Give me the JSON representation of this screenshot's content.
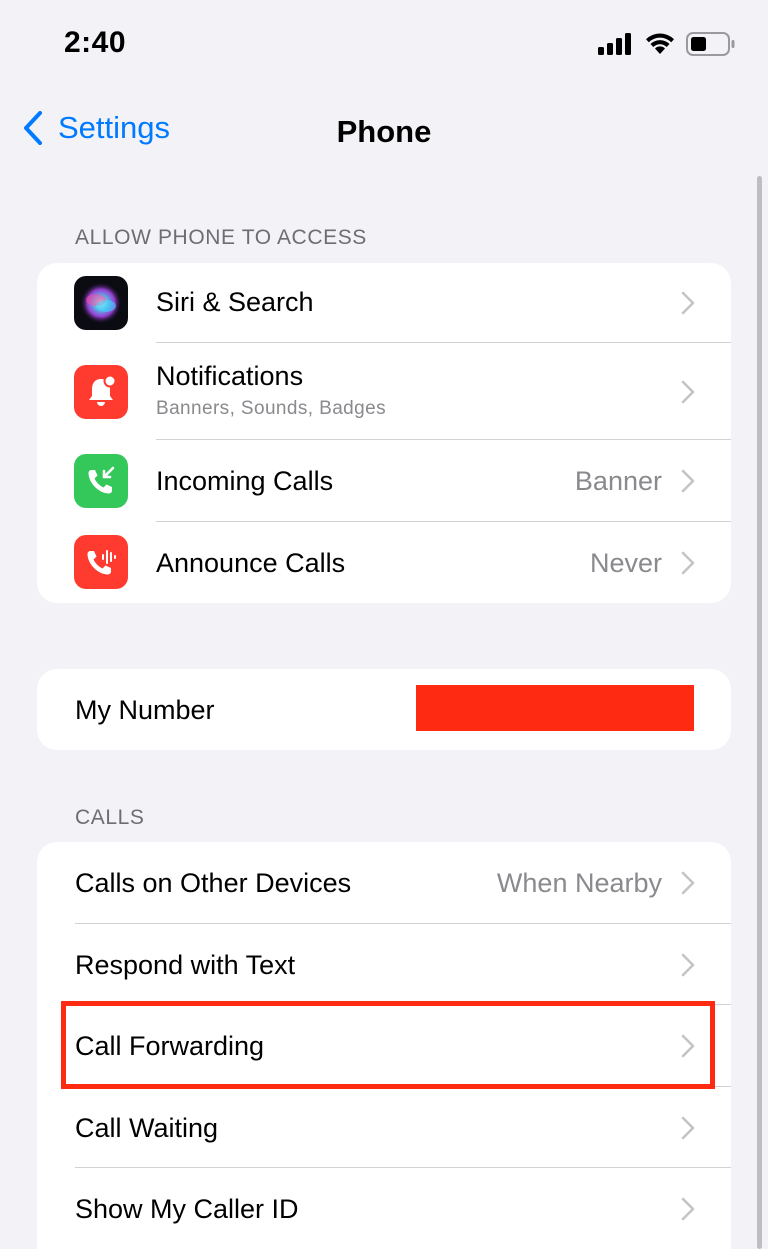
{
  "status_bar": {
    "time": "2:40",
    "icons": [
      "cellular-signal-icon",
      "wifi-icon",
      "battery-icon"
    ]
  },
  "nav": {
    "back_label": "Settings",
    "title": "Phone"
  },
  "sections": {
    "access_header": "ALLOW PHONE TO ACCESS",
    "calls_header": "CALLS"
  },
  "access_items": [
    {
      "label": "Siri & Search",
      "sublabel": "",
      "value": "",
      "icon": "siri-icon"
    },
    {
      "label": "Notifications",
      "sublabel": "Banners, Sounds, Badges",
      "value": "",
      "icon": "notifications-icon"
    },
    {
      "label": "Incoming Calls",
      "sublabel": "",
      "value": "Banner",
      "icon": "incoming-calls-icon"
    },
    {
      "label": "Announce Calls",
      "sublabel": "",
      "value": "Never",
      "icon": "announce-calls-icon"
    }
  ],
  "my_number": {
    "label": "My Number"
  },
  "calls_items": [
    {
      "label": "Calls on Other Devices",
      "value": "When Nearby"
    },
    {
      "label": "Respond with Text",
      "value": ""
    },
    {
      "label": "Call Forwarding",
      "value": ""
    },
    {
      "label": "Call Waiting",
      "value": ""
    },
    {
      "label": "Show My Caller ID",
      "value": ""
    }
  ],
  "colors": {
    "accent": "#007aff",
    "background": "#f2f2f7",
    "notifications_icon_bg": "#ff3b30",
    "incoming_calls_icon_bg": "#34c759",
    "announce_calls_icon_bg": "#ff3b30",
    "redaction": "#ff2a12",
    "highlight": "#ff2a12"
  }
}
